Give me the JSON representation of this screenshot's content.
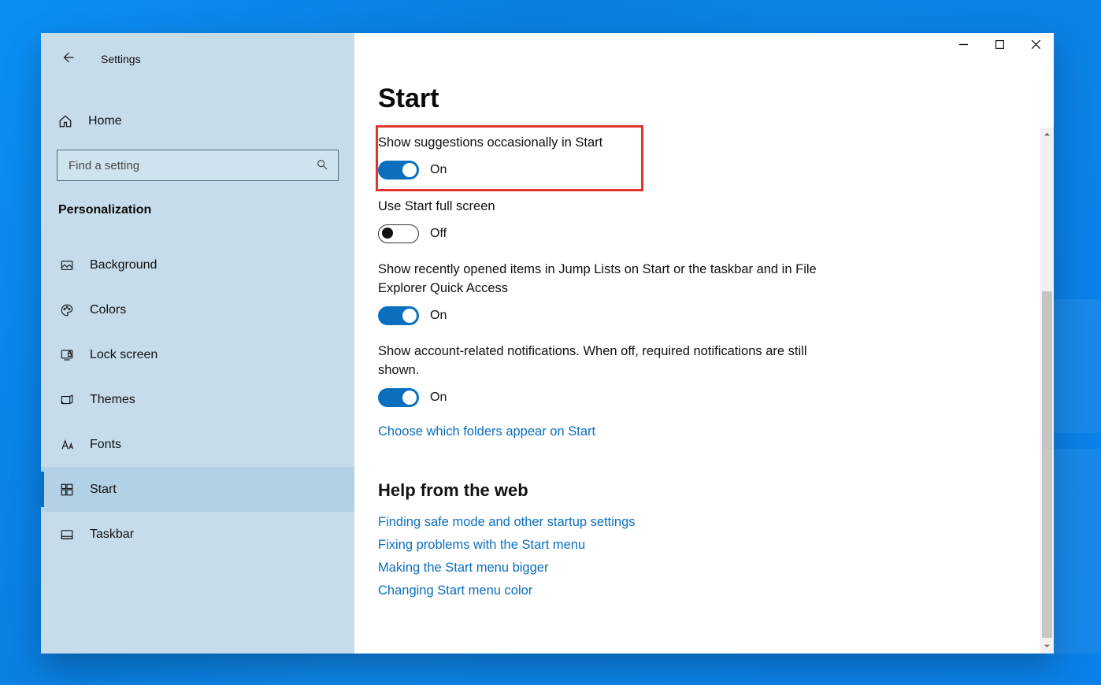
{
  "header": {
    "app_title": "Settings"
  },
  "sidebar": {
    "home_label": "Home",
    "search_placeholder": "Find a setting",
    "category_title": "Personalization",
    "items": [
      {
        "label": "Background",
        "icon": "image"
      },
      {
        "label": "Colors",
        "icon": "palette"
      },
      {
        "label": "Lock screen",
        "icon": "lock-screen"
      },
      {
        "label": "Themes",
        "icon": "themes"
      },
      {
        "label": "Fonts",
        "icon": "fonts"
      },
      {
        "label": "Start",
        "icon": "start",
        "selected": true
      },
      {
        "label": "Taskbar",
        "icon": "taskbar"
      }
    ]
  },
  "main": {
    "page_title": "Start",
    "settings": [
      {
        "label": "Show suggestions occasionally in Start",
        "state": "On",
        "on": true,
        "highlight": true
      },
      {
        "label": "Use Start full screen",
        "state": "Off",
        "on": false
      },
      {
        "label": "Show recently opened items in Jump Lists on Start or the taskbar and in File Explorer Quick Access",
        "state": "On",
        "on": true
      },
      {
        "label": "Show account-related notifications. When off, required notifications are still shown.",
        "state": "On",
        "on": true
      }
    ],
    "choose_folders_link": "Choose which folders appear on Start",
    "help_header": "Help from the web",
    "help_links": [
      "Finding safe mode and other startup settings",
      "Fixing problems with the Start menu",
      "Making the Start menu bigger",
      "Changing Start menu color"
    ]
  }
}
